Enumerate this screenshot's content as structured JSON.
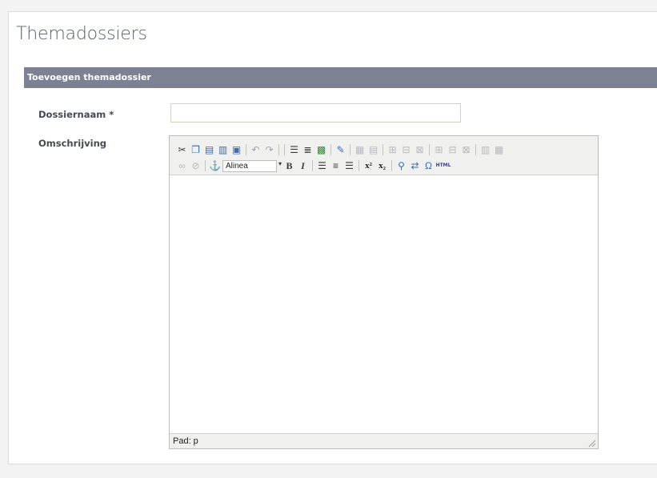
{
  "page": {
    "title": "Themadossiers"
  },
  "section": {
    "title": "Toevoegen themadossier"
  },
  "form": {
    "name_label": "Dossiernaam *",
    "name_value": "",
    "description_label": "Omschrijving"
  },
  "editor": {
    "format_select": "Alinea",
    "bold_label": "B",
    "italic_label": "I",
    "html_label": "HTML",
    "path_label": "Pad: p",
    "content": ""
  },
  "colors": {
    "section_bar": "#7d8194",
    "title_text": "#555e6b",
    "input_border": "#d8d2bd",
    "toolbar_bg": "#f0f0ee"
  },
  "icons": {
    "row1": [
      "cut-icon",
      "copy-icon",
      "paste-icon",
      "paste-text-icon",
      "paste-word-icon",
      "undo-icon",
      "redo-icon",
      "bullet-list-icon",
      "numbered-list-icon",
      "image-icon",
      "edit-icon",
      "table-icon",
      "table-props-icon",
      "row-before-icon",
      "row-after-icon",
      "delete-row-icon",
      "col-before-icon",
      "col-after-icon",
      "delete-col-icon",
      "split-cells-icon",
      "merge-cells-icon"
    ],
    "row2": [
      "link-icon",
      "unlink-icon",
      "anchor-icon",
      "bold-icon",
      "italic-icon",
      "align-left-icon",
      "align-center-icon",
      "align-right-icon",
      "superscript-icon",
      "subscript-icon",
      "find-icon",
      "replace-icon",
      "special-char-icon",
      "html-source-icon"
    ]
  }
}
